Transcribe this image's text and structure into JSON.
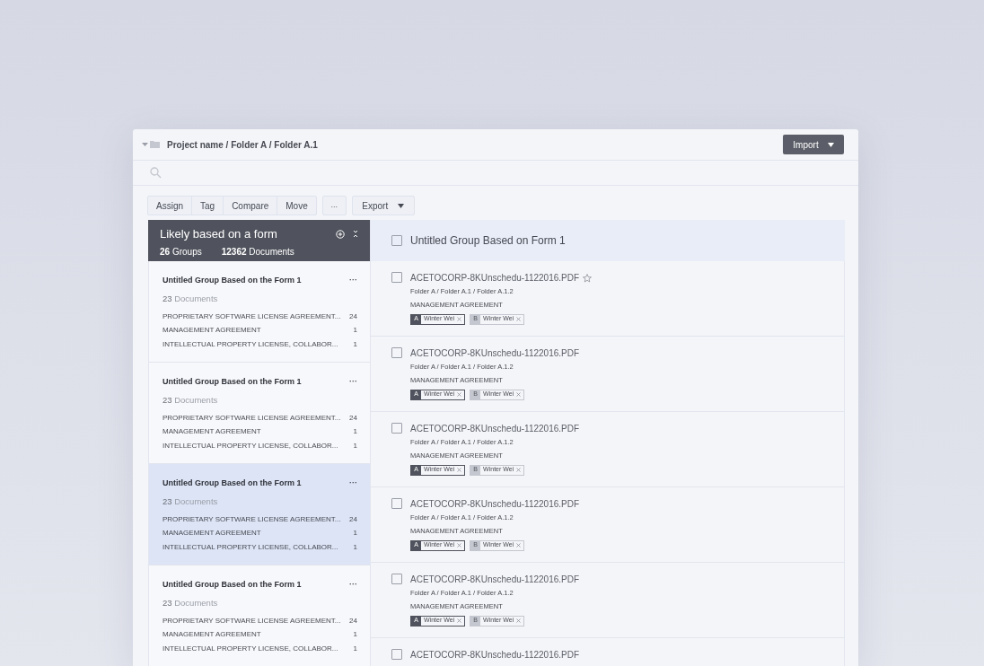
{
  "breadcrumb": "Project name / Folder A / Folder A.1",
  "import_button": "Import",
  "toolbar": [
    "Assign",
    "Tag",
    "Compare",
    "Move"
  ],
  "more_button": "...",
  "export_button": "Export",
  "group_panel": {
    "title": "Likely based on a form",
    "groups_count": "26",
    "groups_label": "Groups",
    "documents_count": "12362",
    "documents_label": "Documents"
  },
  "groups": [
    {
      "title": "Untitled Group Based on the Form 1",
      "more": "···",
      "count": "23",
      "count_label": "Documents",
      "selected": false,
      "types": [
        {
          "name": "PROPRIETARY SOFTWARE LICENSE AGREEMENT...",
          "count": "24"
        },
        {
          "name": "MANAGEMENT AGREEMENT",
          "count": "1"
        },
        {
          "name": "INTELLECTUAL PROPERTY LICENSE, COLLABOR...",
          "count": "1"
        }
      ]
    },
    {
      "title": "Untitled Group Based on the Form 1",
      "more": "···",
      "count": "23",
      "count_label": "Documents",
      "selected": false,
      "types": [
        {
          "name": "PROPRIETARY SOFTWARE LICENSE AGREEMENT...",
          "count": "24"
        },
        {
          "name": "MANAGEMENT AGREEMENT",
          "count": "1"
        },
        {
          "name": "INTELLECTUAL PROPERTY LICENSE, COLLABOR...",
          "count": "1"
        }
      ]
    },
    {
      "title": "Untitled Group Based on the Form 1",
      "more": "···",
      "count": "23",
      "count_label": "Documents",
      "selected": true,
      "types": [
        {
          "name": "PROPRIETARY SOFTWARE LICENSE AGREEMENT...",
          "count": "24"
        },
        {
          "name": "MANAGEMENT AGREEMENT",
          "count": "1"
        },
        {
          "name": "INTELLECTUAL PROPERTY LICENSE, COLLABOR...",
          "count": "1"
        }
      ]
    },
    {
      "title": "Untitled Group Based on the Form 1",
      "more": "···",
      "count": "23",
      "count_label": "Documents",
      "selected": false,
      "types": [
        {
          "name": "PROPRIETARY SOFTWARE LICENSE AGREEMENT...",
          "count": "24"
        },
        {
          "name": "MANAGEMENT AGREEMENT",
          "count": "1"
        },
        {
          "name": "INTELLECTUAL PROPERTY LICENSE, COLLABOR...",
          "count": "1"
        }
      ]
    }
  ],
  "detail": {
    "title": "Untitled Group Based on Form 1",
    "checked": false
  },
  "documents": [
    {
      "file": "ACETOCORP-8KUnschedu-1122016.PDF",
      "checked": false,
      "starred": true,
      "path": "Folder A / Folder A.1 / Folder A.1.2",
      "type": "MANAGEMENT AGREEMENT",
      "tags": [
        {
          "letter": "A",
          "name": "Winter Wei",
          "active": true
        },
        {
          "letter": "B",
          "name": "Winter Wei",
          "active": false
        }
      ]
    },
    {
      "file": "ACETOCORP-8KUnschedu-1122016.PDF",
      "checked": false,
      "starred": false,
      "path": "Folder A / Folder A.1 / Folder A.1.2",
      "type": "MANAGEMENT AGREEMENT",
      "tags": [
        {
          "letter": "A",
          "name": "Winter Wei",
          "active": true
        },
        {
          "letter": "B",
          "name": "Winter Wei",
          "active": false
        }
      ]
    },
    {
      "file": "ACETOCORP-8KUnschedu-1122016.PDF",
      "checked": false,
      "starred": false,
      "path": "Folder A / Folder A.1 / Folder A.1.2",
      "type": "MANAGEMENT AGREEMENT",
      "tags": [
        {
          "letter": "A",
          "name": "Winter Wei",
          "active": true
        },
        {
          "letter": "B",
          "name": "Winter Wei",
          "active": false
        }
      ]
    },
    {
      "file": "ACETOCORP-8KUnschedu-1122016.PDF",
      "checked": false,
      "starred": false,
      "path": "Folder A / Folder A.1 / Folder A.1.2",
      "type": "MANAGEMENT AGREEMENT",
      "tags": [
        {
          "letter": "A",
          "name": "Winter Wei",
          "active": true
        },
        {
          "letter": "B",
          "name": "Winter Wei",
          "active": false
        }
      ]
    },
    {
      "file": "ACETOCORP-8KUnschedu-1122016.PDF",
      "checked": false,
      "starred": false,
      "path": "Folder A / Folder A.1 / Folder A.1.2",
      "type": "MANAGEMENT AGREEMENT",
      "tags": [
        {
          "letter": "A",
          "name": "Winter Wei",
          "active": true
        },
        {
          "letter": "B",
          "name": "Winter Wei",
          "active": false
        }
      ]
    },
    {
      "file": "ACETOCORP-8KUnschedu-1122016.PDF",
      "checked": false,
      "starred": false
    }
  ]
}
